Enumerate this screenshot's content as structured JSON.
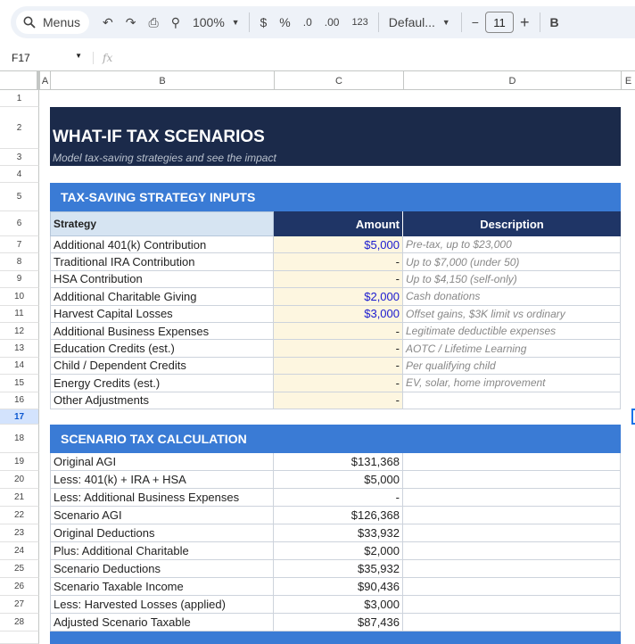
{
  "toolbar": {
    "search_label": "Menus",
    "zoom": "100%",
    "currency": "$",
    "percent": "%",
    "dec_decrease": ".0",
    "dec_increase": ".00",
    "number_format": "123",
    "font": "Defaul...",
    "font_size": "11",
    "bold": "B"
  },
  "formula_bar": {
    "cell_ref": "F17",
    "fx": "fx",
    "value": ""
  },
  "columns": [
    "A",
    "B",
    "C",
    "D",
    "E"
  ],
  "selected_row": "17",
  "colors": {
    "title_bg": "#1b2a4a",
    "section_bg": "#3a7bd5",
    "header_dark": "#1f3566",
    "header_light": "#d6e4f2",
    "input_bg": "#fdf6e0",
    "input_text": "#1a1acf"
  },
  "sheet": {
    "title": "WHAT-IF TAX SCENARIOS",
    "subtitle": "Model tax-saving strategies and see the impact",
    "section1": "TAX-SAVING STRATEGY INPUTS",
    "headers": {
      "strategy": "Strategy",
      "amount": "Amount",
      "description": "Description"
    },
    "inputs": [
      {
        "label": "Additional 401(k) Contribution",
        "amount": "$5,000",
        "desc": "Pre-tax, up to $23,000"
      },
      {
        "label": "Traditional IRA Contribution",
        "amount": "-",
        "desc": "Up to $7,000 (under 50)"
      },
      {
        "label": "HSA Contribution",
        "amount": "-",
        "desc": "Up to $4,150 (self-only)"
      },
      {
        "label": "Additional Charitable Giving",
        "amount": "$2,000",
        "desc": "Cash donations"
      },
      {
        "label": "Harvest Capital Losses",
        "amount": "$3,000",
        "desc": "Offset gains, $3K limit vs ordinary"
      },
      {
        "label": "Additional Business Expenses",
        "amount": "-",
        "desc": "Legitimate deductible expenses"
      },
      {
        "label": "Education Credits (est.)",
        "amount": "-",
        "desc": "AOTC / Lifetime Learning"
      },
      {
        "label": "Child / Dependent Credits",
        "amount": "-",
        "desc": "Per qualifying child"
      },
      {
        "label": "Energy Credits (est.)",
        "amount": "-",
        "desc": "EV, solar, home improvement"
      },
      {
        "label": "Other Adjustments",
        "amount": "-",
        "desc": ""
      }
    ],
    "section2": "SCENARIO TAX CALCULATION",
    "calc": [
      {
        "label": "Original AGI",
        "amount": "$131,368"
      },
      {
        "label": "Less: 401(k) + IRA + HSA",
        "amount": "$5,000"
      },
      {
        "label": "Less: Additional Business Expenses",
        "amount": "-"
      },
      {
        "label": "Scenario AGI",
        "amount": "$126,368"
      },
      {
        "label": "Original Deductions",
        "amount": "$33,932"
      },
      {
        "label": "Plus: Additional Charitable",
        "amount": "$2,000"
      },
      {
        "label": "Scenario Deductions",
        "amount": "$35,932"
      },
      {
        "label": "Scenario Taxable Income",
        "amount": "$90,436"
      },
      {
        "label": "Less: Harvested Losses (applied)",
        "amount": "$3,000"
      },
      {
        "label": "Adjusted Scenario Taxable",
        "amount": "$87,436"
      }
    ]
  }
}
